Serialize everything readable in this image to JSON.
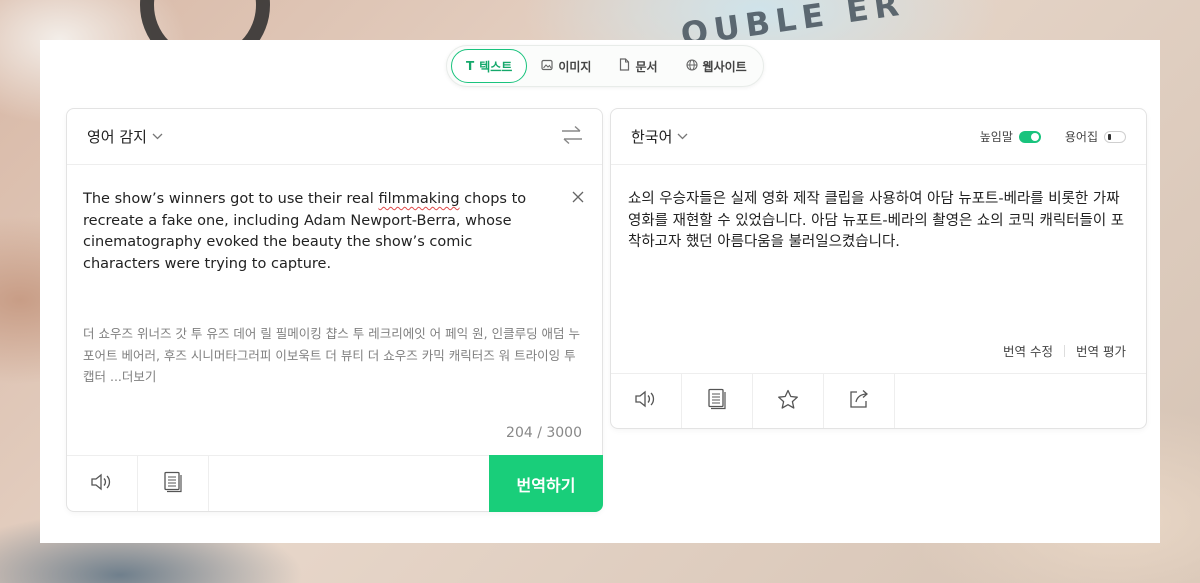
{
  "mode_tabs": [
    {
      "label": "텍스트",
      "icon": "text-icon",
      "glyph": "T",
      "active": true
    },
    {
      "label": "이미지",
      "icon": "image-icon",
      "glyph": "▣",
      "active": false
    },
    {
      "label": "문서",
      "icon": "document-icon",
      "glyph": "▯",
      "active": false
    },
    {
      "label": "웹사이트",
      "icon": "globe-icon",
      "glyph": "⊕",
      "active": false
    }
  ],
  "source": {
    "language": "영어 감지",
    "text_before": "The show’s winners got to use their real ",
    "text_misspelled": "filmmaking",
    "text_after": " chops to recreate a fake one, including Adam Newport-Berra, whose cinematography evoked the beauty the show’s comic characters were trying to capture.",
    "pronunciation": "더 쇼우즈 위너즈 갓 투 유즈 데어 릴 필메이킹 챱스 투 레크리에잇 어 페익 원, 인클루딩 애덤 누포어트 베어러, 후즈 시니머타그러피 이보욱트 더 뷰티 더 쇼우즈 카믹 캐릭터즈 워 트라이잉 투 캡터 ...",
    "more_label": "더보기",
    "char_count": "204 / 3000",
    "translate_label": "번역하기"
  },
  "target": {
    "language": "한국어",
    "honorific_label": "높임말",
    "honorific_on": true,
    "glossary_label": "용어집",
    "glossary_on": false,
    "text": "쇼의 우승자들은 실제 영화 제작 클립을 사용하여 아담 뉴포트-베라를 비롯한 가짜 영화를 재현할 수 있었습니다. 아담 뉴포트-베라의 촬영은 쇼의 코믹 캐릭터들이 포착하고자 했던 아름다움을 불러일으켰습니다.",
    "edit_label": "번역 수정",
    "rate_label": "번역 평가"
  },
  "colors": {
    "accent": "#19c37d",
    "translate_button": "#19ce7a"
  }
}
